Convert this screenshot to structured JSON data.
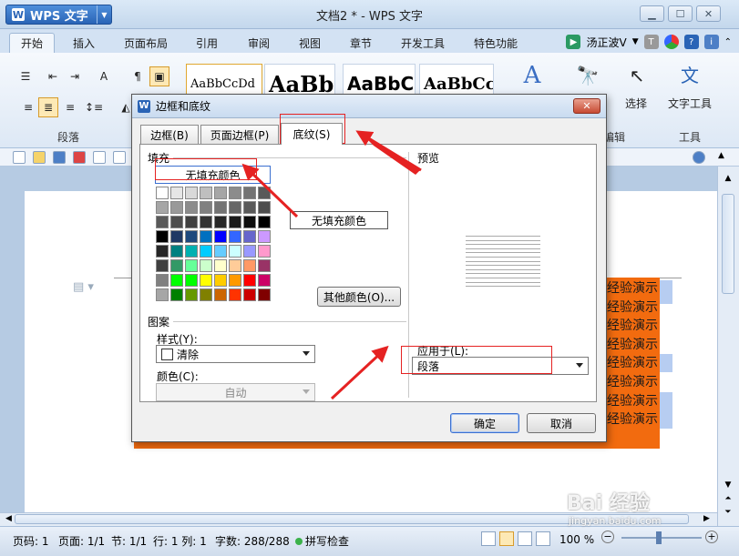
{
  "app": {
    "button_label": "WPS 文字",
    "window_title": "文档2 * - WPS 文字"
  },
  "ribbon": {
    "tabs": [
      "开始",
      "插入",
      "页面布局",
      "引用",
      "审阅",
      "视图",
      "章节",
      "开发工具",
      "特色功能"
    ],
    "user": "汤正波V",
    "styles": [
      "AaBbCcDd",
      "AaBb(",
      "AaBbC(",
      "AaBbCc"
    ],
    "group_paragraph": "段落",
    "group_edit": "编辑",
    "group_tools": "工具",
    "select_label": "选择",
    "tools_label": "文字工具"
  },
  "document": {
    "demo_text": "经验演示",
    "demo_rows": 8
  },
  "dialog": {
    "title": "边框和底纹",
    "tabs": [
      "边框(B)",
      "页面边框(P)",
      "底纹(S)"
    ],
    "fill_label": "填充",
    "no_fill": "无填充颜色",
    "other_colors": "其他颜色(O)...",
    "pattern_label": "图案",
    "style_label": "样式(Y):",
    "style_value": "清除",
    "color_label": "颜色(C):",
    "color_value": "自动",
    "preview_label": "预览",
    "apply_label": "应用于(L):",
    "apply_value": "段落",
    "ok": "确定",
    "cancel": "取消",
    "palette": [
      [
        "#ffffff",
        "#e6e6e6",
        "#d9d9d9",
        "#bfbfbf",
        "#a6a6a6",
        "#8c8c8c",
        "#737373",
        "#595959"
      ],
      [
        "#a6a6a6",
        "#999999",
        "#8c8c8c",
        "#808080",
        "#737373",
        "#666666",
        "#595959",
        "#4d4d4d"
      ],
      [
        "#595959",
        "#4d4d4d",
        "#404040",
        "#333333",
        "#262626",
        "#1a1a1a",
        "#0d0d0d",
        "#000000"
      ],
      [
        "#000000",
        "#1f3864",
        "#1f497d",
        "#0070c0",
        "#0000ff",
        "#3366ff",
        "#6666cc",
        "#cc99ff"
      ],
      [
        "#262626",
        "#008080",
        "#00b0b0",
        "#00ccff",
        "#66ccff",
        "#ccffff",
        "#9999ff",
        "#ff99cc"
      ],
      [
        "#404040",
        "#339966",
        "#66ff99",
        "#ccffcc",
        "#ffffcc",
        "#ffcc99",
        "#ff9966",
        "#993366"
      ],
      [
        "#808080",
        "#00ff00",
        "#00ff00",
        "#ffff00",
        "#ffcc00",
        "#ff9900",
        "#ff0000",
        "#cc0066"
      ],
      [
        "#a6a6a6",
        "#008000",
        "#669900",
        "#808000",
        "#cc6600",
        "#ff3300",
        "#cc0000",
        "#800000"
      ]
    ]
  },
  "callout": {
    "text": "无填充颜色"
  },
  "statusbar": {
    "page_num": "页码: 1",
    "pages": "页面: 1/1",
    "section": "节: 1/1",
    "row_col": "行: 1  列: 1",
    "chars": "字数: 288/288",
    "spell": "拼写检查",
    "zoom": "100 %"
  },
  "watermark": {
    "brand": "Bai 经验",
    "url": "jingyan.baidu.com"
  }
}
